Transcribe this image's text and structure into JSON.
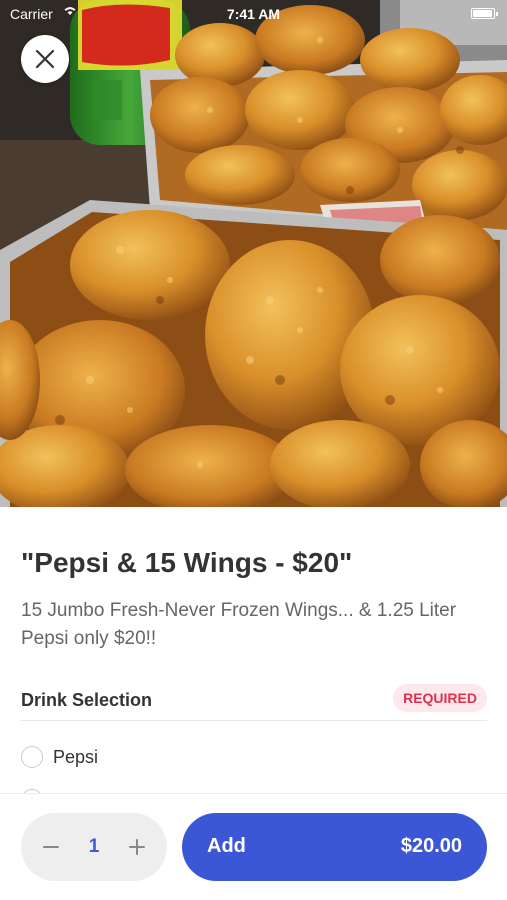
{
  "status_bar": {
    "carrier": "Carrier",
    "time": "7:41 AM"
  },
  "hero": {
    "image_description": "fried chicken wings in aluminum trays with a soda bottle in the background"
  },
  "item": {
    "title": "\"Pepsi & 15 Wings - $20\"",
    "description": "15 Jumbo Fresh-Never Frozen Wings...  & 1.25 Liter Pepsi only $20!!"
  },
  "drink_section": {
    "title": "Drink Selection",
    "badge": "REQUIRED",
    "options": [
      "Pepsi"
    ]
  },
  "cart": {
    "quantity": "1",
    "add_label": "Add",
    "price": "$20.00"
  },
  "colors": {
    "accent": "#3b57d6",
    "required_text": "#e0304e",
    "required_bg": "#fde8ec"
  },
  "icons": [
    "close-icon",
    "wifi-icon",
    "battery-icon",
    "minus-icon",
    "plus-icon"
  ]
}
